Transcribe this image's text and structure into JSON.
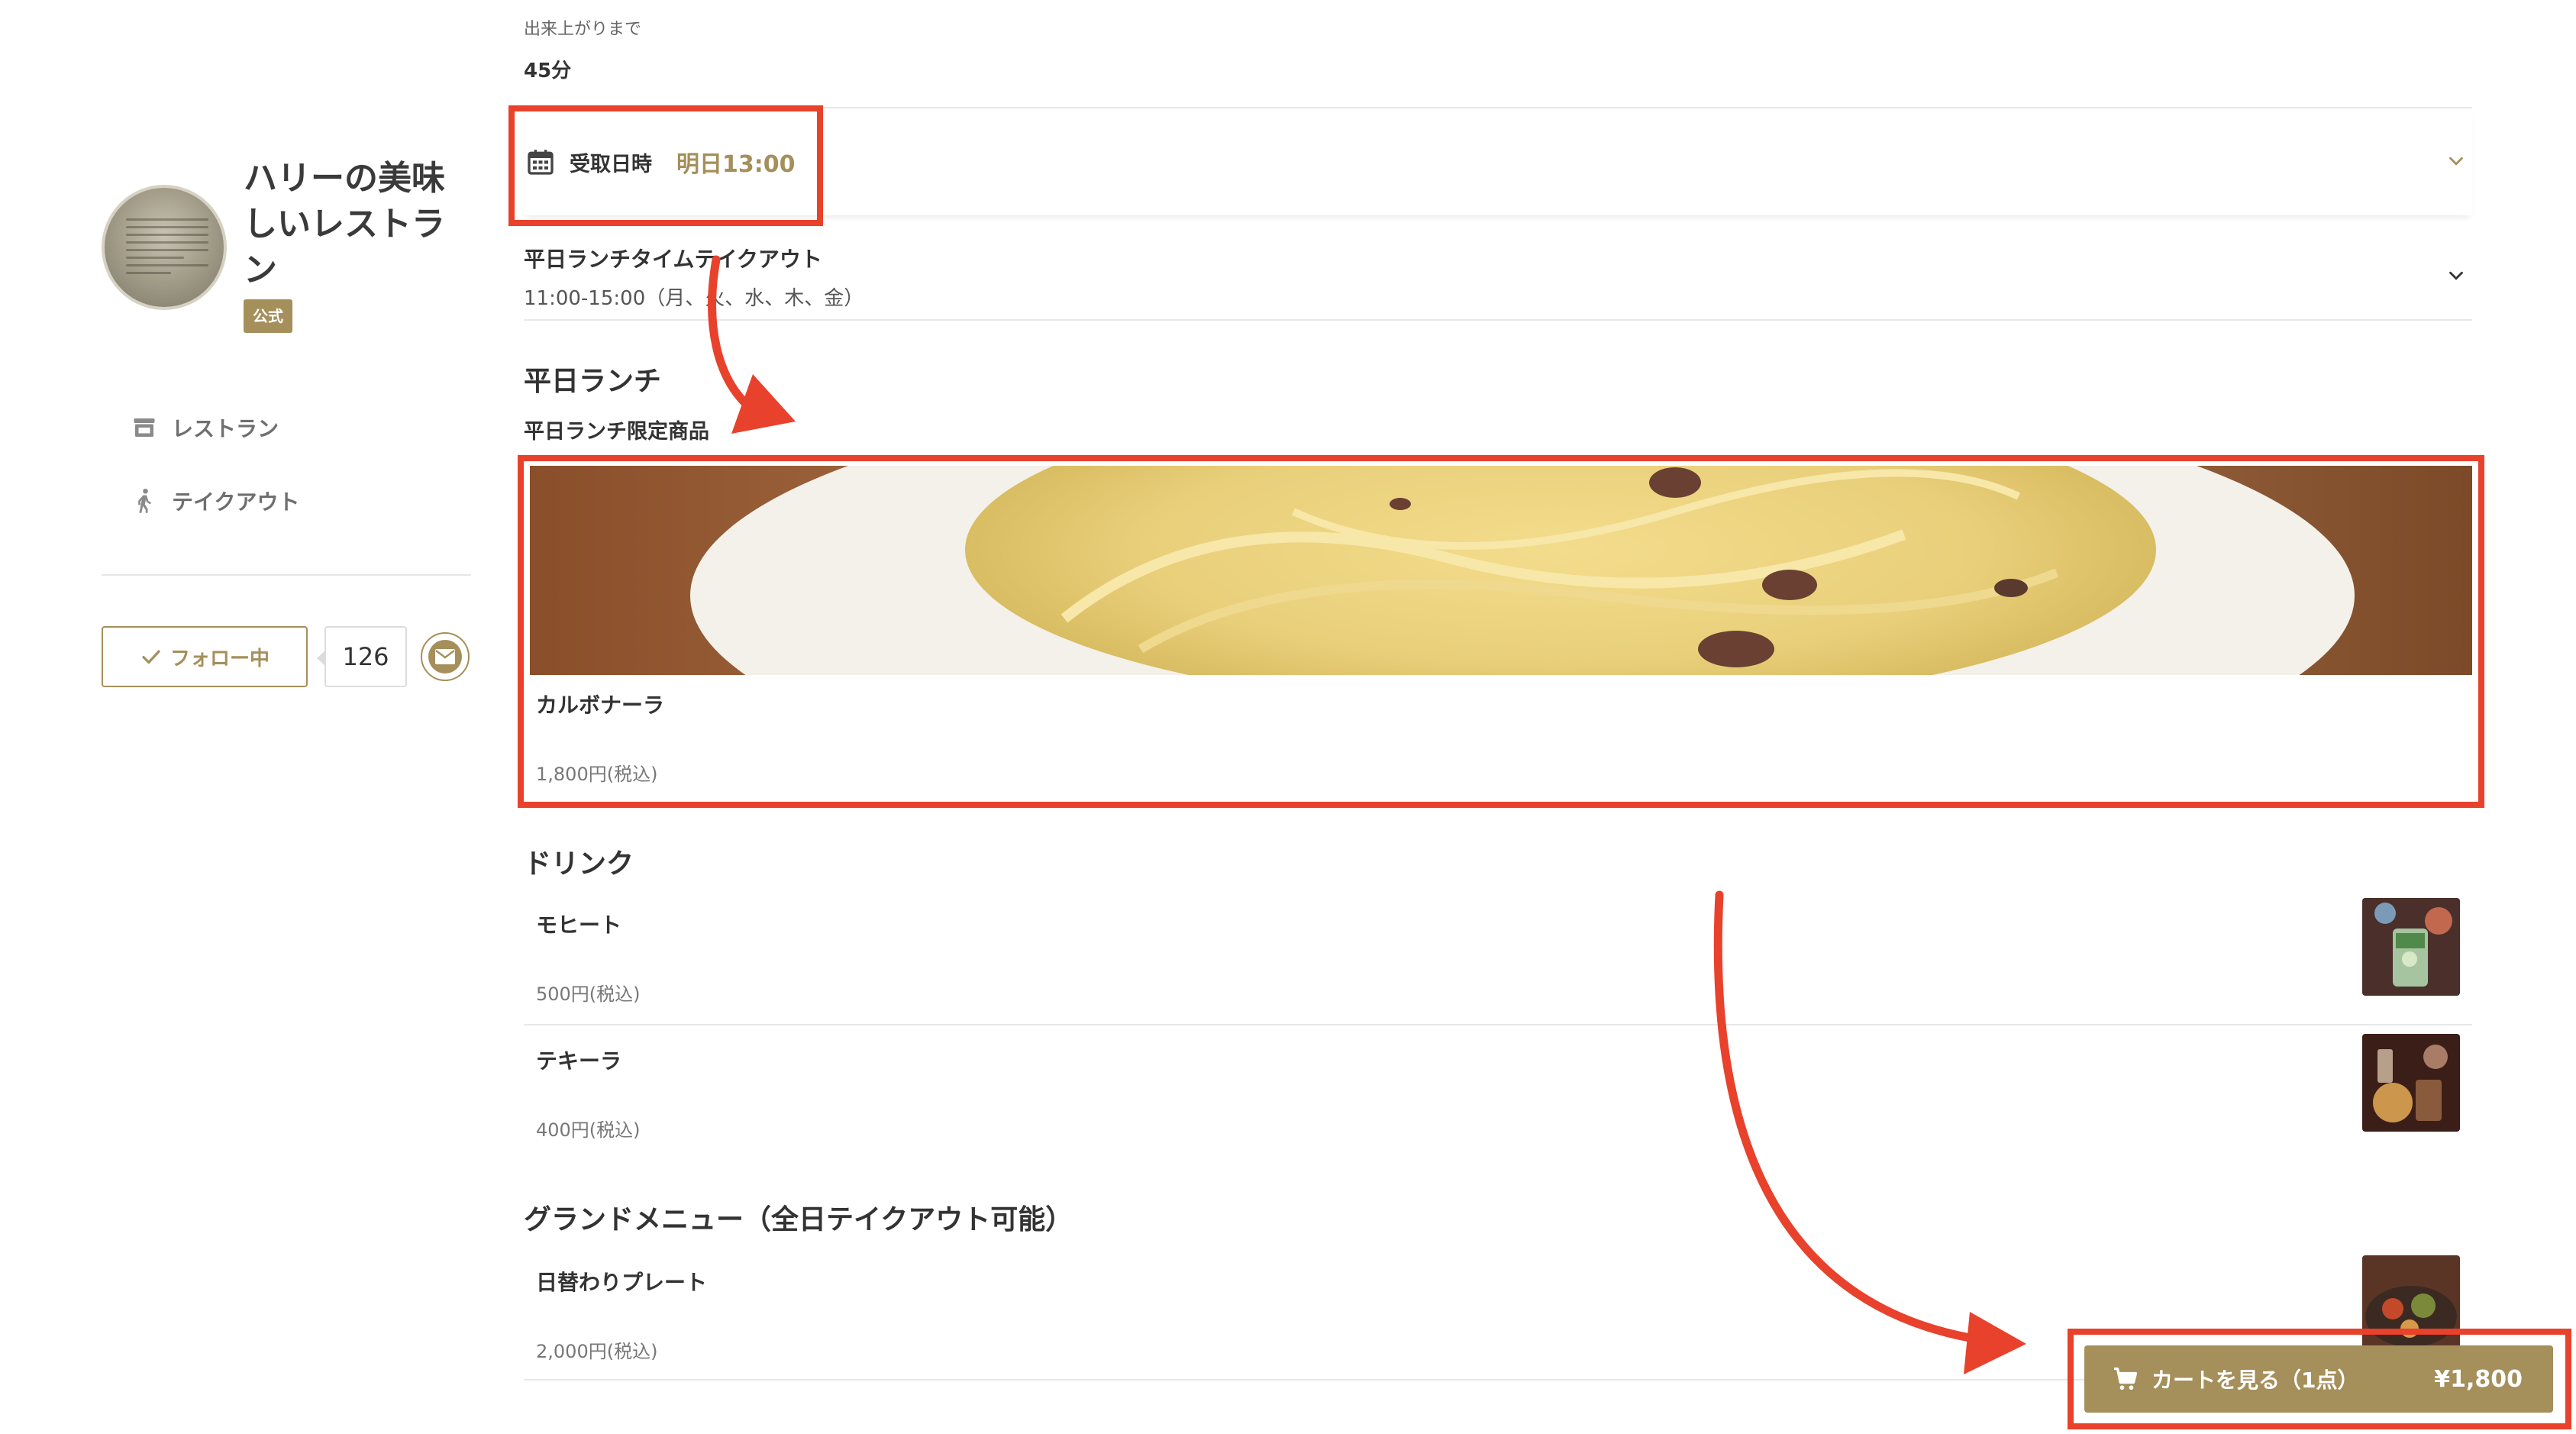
{
  "sidebar": {
    "shop_name": "ハリーの美味しいレストラン",
    "official_badge": "公式",
    "nav": [
      {
        "label": "レストラン",
        "icon": "store-icon"
      },
      {
        "label": "テイクアウト",
        "icon": "walking-person-icon"
      }
    ],
    "follow_label": "フォロー中",
    "follow_count": "126"
  },
  "order": {
    "eta_label": "出来上がりまで",
    "eta_value": "45分",
    "pickup_label": "受取日時",
    "pickup_value": "明日13:00",
    "hours_title": "平日ランチタイムテイクアウト",
    "hours_detail": "11:00-15:00（月、火、水、木、金）"
  },
  "menu": {
    "lunch": {
      "title": "平日ランチ",
      "subtitle": "平日ランチ限定商品",
      "featured": {
        "name": "カルボナーラ",
        "price": "1,800円(税込)"
      }
    },
    "drinks": {
      "title": "ドリンク",
      "items": [
        {
          "name": "モヒート",
          "price": "500円(税込)"
        },
        {
          "name": "テキーラ",
          "price": "400円(税込)"
        }
      ]
    },
    "grand": {
      "title": "グランドメニュー（全日テイクアウト可能）",
      "items": [
        {
          "name": "日替わりプレート",
          "price": "2,000円(税込)"
        }
      ]
    }
  },
  "cart": {
    "label": "カートを見る（1点）",
    "total": "¥1,800"
  },
  "colors": {
    "accent": "#a58f5a",
    "annotation": "#e8412c"
  }
}
